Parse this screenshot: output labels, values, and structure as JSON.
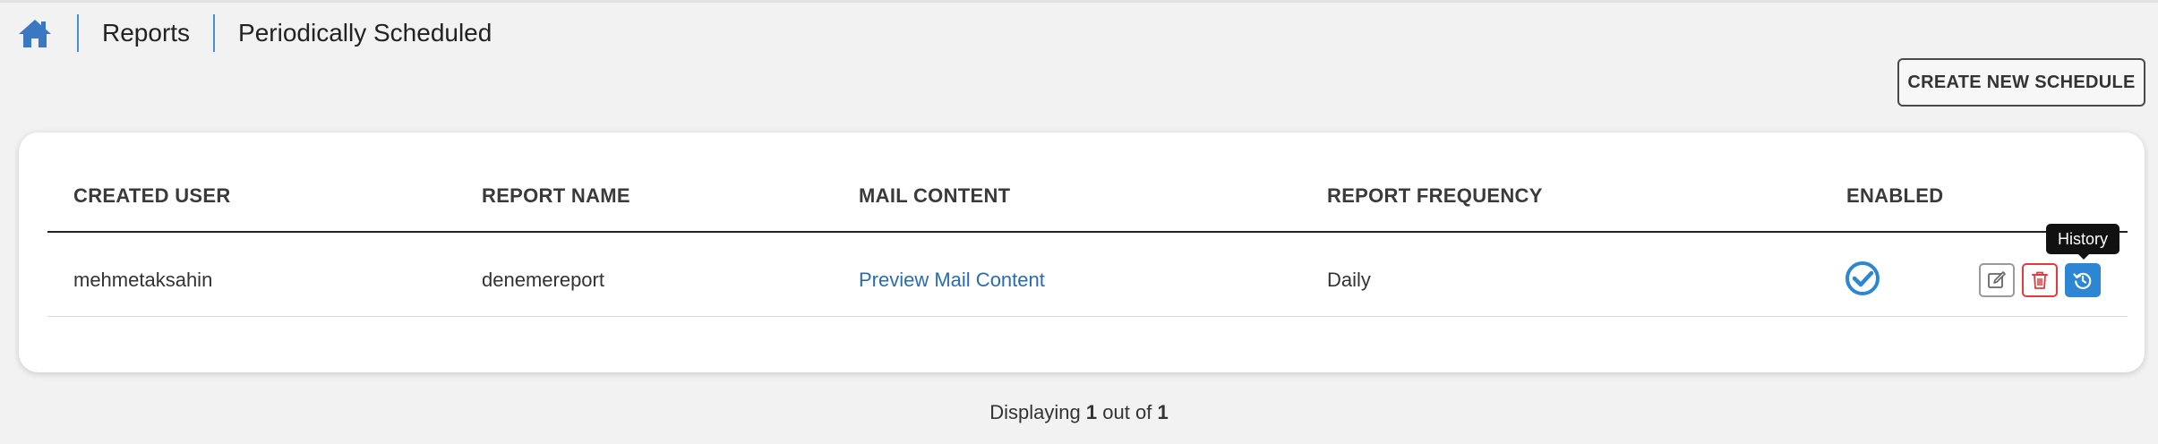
{
  "breadcrumb": {
    "home_icon": "home-icon",
    "items": [
      "Reports",
      "Periodically Scheduled"
    ]
  },
  "toolbar": {
    "create_label": "CREATE NEW SCHEDULE"
  },
  "table": {
    "headers": [
      "CREATED USER",
      "REPORT NAME",
      "MAIL CONTENT",
      "REPORT FREQUENCY",
      "ENABLED"
    ],
    "rows": [
      {
        "created_user": "mehmetaksahin",
        "report_name": "denemereport",
        "mail_content": "Preview Mail Content",
        "report_frequency": "Daily",
        "enabled": true
      }
    ],
    "actions": {
      "edit_icon": "edit-icon",
      "delete_icon": "trash-icon",
      "history_icon": "history-icon",
      "history_tooltip": "History"
    }
  },
  "pagination": {
    "prefix": "Displaying",
    "current": "1",
    "middle": "out of",
    "total": "1"
  },
  "colors": {
    "accent": "#2d86d3",
    "link": "#2b6cb0",
    "danger": "#e23b3b",
    "home_icon": "#3a78c2"
  }
}
